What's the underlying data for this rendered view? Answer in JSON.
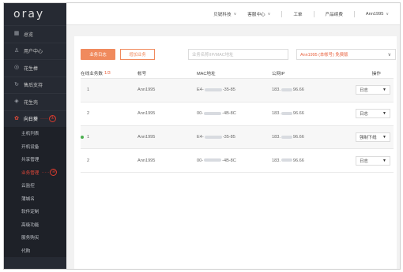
{
  "app": {
    "logo": "oray"
  },
  "sidebar": {
    "items": [
      {
        "icon": "grid-icon",
        "label": "总览"
      },
      {
        "icon": "user-icon",
        "label": "用户中心"
      },
      {
        "icon": "circle-icon",
        "label": "花生棒"
      },
      {
        "icon": "refresh-icon",
        "label": "售后支持"
      },
      {
        "icon": "shield-icon",
        "label": "花生壳"
      },
      {
        "icon": "gear-icon",
        "label": "向日葵",
        "annotation": "①"
      }
    ],
    "sub_items": [
      {
        "label": "主机列表"
      },
      {
        "label": "开机设备"
      },
      {
        "label": "共享管理"
      },
      {
        "label": "业务管理",
        "annotation": "②"
      },
      {
        "label": "云监控"
      },
      {
        "label": "蒲城名"
      },
      {
        "label": "软件定制"
      },
      {
        "label": "高级功能"
      },
      {
        "label": "服务购买"
      },
      {
        "label": "代购"
      }
    ]
  },
  "topbar": {
    "items": [
      {
        "label": "贝锐科技",
        "dropdown": true
      },
      {
        "label": "客服中心",
        "dropdown": true
      },
      {
        "label": "工单",
        "dropdown": false
      },
      {
        "label": "产品续费",
        "dropdown": false
      },
      {
        "label": "Ann1995",
        "dropdown": true
      }
    ]
  },
  "toolbar": {
    "primary_button": "业务日志",
    "secondary_button": "增加业务",
    "search_placeholder": "业务名称/IP/MAC地址",
    "select_value": "Ann1995 (本帐号) 免费版"
  },
  "table": {
    "headers": [
      "在线业务数",
      "帐号",
      "MAC地址",
      "公网IP",
      "操作"
    ],
    "online_count": "1/3",
    "rows": [
      {
        "num": "1",
        "online": false,
        "account": "Ann1995",
        "mac_prefix": "E4-",
        "mac_suffix": "-35-85",
        "ip_prefix": "183.",
        "ip_suffix": "96.66",
        "action": "日志"
      },
      {
        "num": "2",
        "online": false,
        "account": "Ann1995",
        "mac_prefix": "00-",
        "mac_suffix": "-4B-8C",
        "ip_prefix": "183.",
        "ip_suffix": "96.66",
        "action": "日志"
      },
      {
        "num": "1",
        "online": true,
        "account": "Ann1995",
        "mac_prefix": "E4-",
        "mac_suffix": "-35-85",
        "ip_prefix": "183.",
        "ip_suffix": "96.66",
        "action": "强制下线"
      },
      {
        "num": "2",
        "online": false,
        "account": "Ann1995",
        "mac_prefix": "00-",
        "mac_suffix": "-4B-8C",
        "ip_prefix": "183.",
        "ip_suffix": "96.66",
        "action": "日志"
      }
    ]
  },
  "colors": {
    "accent": "#f08a5d",
    "sidebar": "#262a33",
    "annotation": "#d83b2e",
    "online": "#4caf50"
  }
}
